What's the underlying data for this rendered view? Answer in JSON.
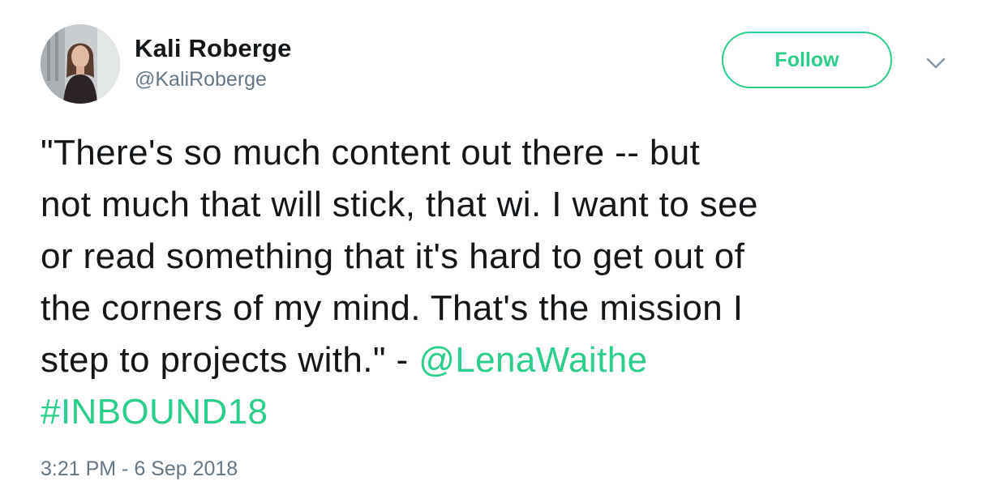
{
  "author": {
    "name": "Kali Roberge",
    "handle": "@KaliRoberge"
  },
  "follow_label": "Follow",
  "menu_icon": "chevron-down-icon",
  "tweet": {
    "line1": "\"There's so much content out there -- but",
    "line2": "not much that will stick, that wi. I want to see",
    "line3": "or read something that it's hard to get out of",
    "line4": "the corners of my mind. That's the mission I",
    "line5_text": "step to projects with.\" - ",
    "mention": "@LenaWaithe",
    "hashtag": "#INBOUND18"
  },
  "timestamp": "3:21 PM - 6 Sep 2018",
  "colors": {
    "accent": "#2bce8b",
    "text": "#14171a",
    "secondary": "#657786"
  }
}
